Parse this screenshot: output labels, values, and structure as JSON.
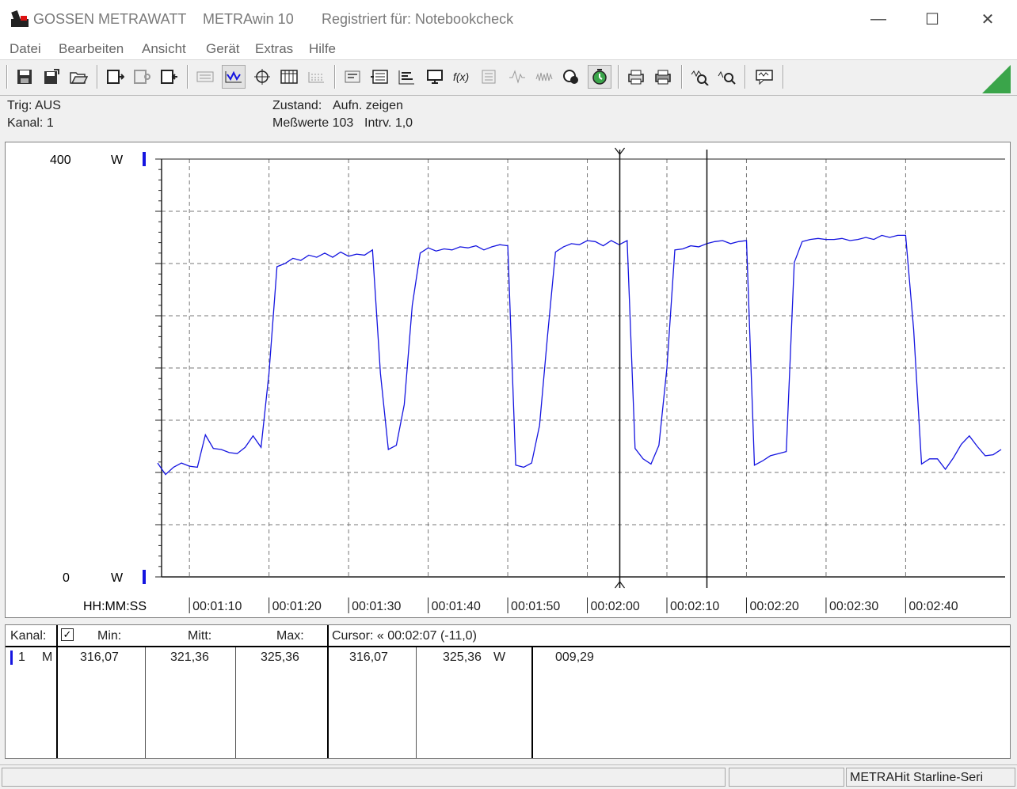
{
  "titlebar": {
    "brand": "GOSSEN METRAWATT",
    "app_name": "METRAwin 10",
    "registration": "Registriert für: Notebookcheck",
    "minimize_glyph": "—",
    "maximize_glyph": "☐",
    "close_glyph": "✕"
  },
  "menu": [
    "Datei",
    "Bearbeiten",
    "Ansicht",
    "Gerät",
    "Extras",
    "Hilfe"
  ],
  "toolbar": {
    "icons": [
      "save-icon",
      "save-as-icon",
      "open-folder-icon",
      "device-read-icon",
      "device-settings-icon",
      "device-write-icon",
      "text-list-icon",
      "wave-view-icon",
      "cursor-crosshair-icon",
      "table-view-icon",
      "grid-view-icon",
      "scale-icon",
      "channel-config-icon",
      "bar-list-icon",
      "monitor-icon",
      "function-icon",
      "memory-icon",
      "signal-icon",
      "noise-icon",
      "record-icon",
      "timer-icon",
      "print-preview-icon",
      "print-icon",
      "zoom-wave-icon",
      "zoom-icon",
      "message-icon"
    ],
    "active": [
      "wave-view-icon",
      "timer-icon"
    ],
    "accent_color": "#3aa54a"
  },
  "info": {
    "trigger": "Trig: AUS",
    "channel": "Kanal: 1",
    "state_label": "Zustand:",
    "state_value": "Aufn. zeigen",
    "measurements": "Meßwerte 103",
    "interval": "Intrv. 1,0"
  },
  "chart_data": {
    "type": "line",
    "y_unit": "W",
    "y_max_label": "400",
    "y_min_label": "0",
    "ylim": [
      0,
      400
    ],
    "x_label": "HH:MM:SS",
    "x_tick_labels": [
      "00:01:10",
      "00:01:20",
      "00:01:30",
      "00:01:40",
      "00:01:50",
      "00:02:00",
      "00:02:10",
      "00:02:20",
      "00:02:30",
      "00:02:40"
    ],
    "x_tick_seconds": [
      70,
      80,
      90,
      100,
      110,
      120,
      130,
      140,
      150,
      160
    ],
    "xlim": [
      66.5,
      172.5
    ],
    "grid": true,
    "series_color": "#1515e0",
    "cursor_seconds": [
      124,
      135
    ],
    "x": [
      66,
      67,
      68,
      69,
      70,
      71,
      72,
      73,
      74,
      75,
      76,
      77,
      78,
      79,
      80,
      81,
      82,
      83,
      84,
      85,
      86,
      87,
      88,
      89,
      90,
      91,
      92,
      93,
      94,
      95,
      96,
      97,
      98,
      99,
      100,
      101,
      102,
      103,
      104,
      105,
      106,
      107,
      108,
      109,
      110,
      111,
      112,
      113,
      114,
      115,
      116,
      117,
      118,
      119,
      120,
      121,
      122,
      123,
      124,
      125,
      126,
      127,
      128,
      129,
      130,
      131,
      132,
      133,
      134,
      135,
      136,
      137,
      138,
      139,
      140,
      141,
      142,
      143,
      144,
      145,
      146,
      147,
      148,
      149,
      150,
      151,
      152,
      153,
      154,
      155,
      156,
      157,
      158,
      159,
      160,
      161,
      162,
      163,
      164,
      165,
      166,
      167,
      168,
      169,
      170,
      171,
      172
    ],
    "y": [
      109,
      98,
      105,
      109,
      106,
      105,
      136,
      123,
      122,
      119,
      118,
      124,
      135,
      124,
      195,
      297,
      300,
      305,
      303,
      308,
      306,
      310,
      306,
      311,
      307,
      309,
      308,
      313,
      195,
      122,
      126,
      165,
      260,
      310,
      315,
      312,
      314,
      313,
      316,
      315,
      317,
      313,
      316,
      318,
      317,
      107,
      105,
      109,
      145,
      231,
      311,
      316,
      319,
      318,
      322,
      321,
      317,
      322,
      318,
      322,
      123,
      113,
      108,
      126,
      200,
      313,
      314,
      317,
      316,
      319,
      321,
      322,
      319,
      321,
      322,
      107,
      111,
      116,
      118,
      120,
      301,
      321,
      323,
      324,
      323,
      323,
      324,
      322,
      323,
      325,
      323,
      327,
      325,
      327,
      327,
      237,
      108,
      113,
      113,
      103,
      114,
      127,
      135,
      125,
      116,
      117,
      122,
      128,
      124,
      135,
      120
    ],
    "bottom_ticks": "HH:MM:SS"
  },
  "stats": {
    "headers": {
      "channel": "Kanal:",
      "min": "Min:",
      "mean": "Mitt:",
      "max": "Max:",
      "cursor": "Cursor: « 00:02:07 (-11,0)"
    },
    "row": {
      "channel_num": "1",
      "mode": "M",
      "min": "316,07",
      "mean": "321,36",
      "max": "325,36",
      "cursor_min": "316,07",
      "cursor_max": "325,36",
      "unit": "W",
      "delta": "009,29"
    },
    "checkbox_glyph": "✓"
  },
  "statusbar": {
    "device": "METRAHit Starline-Seri"
  }
}
